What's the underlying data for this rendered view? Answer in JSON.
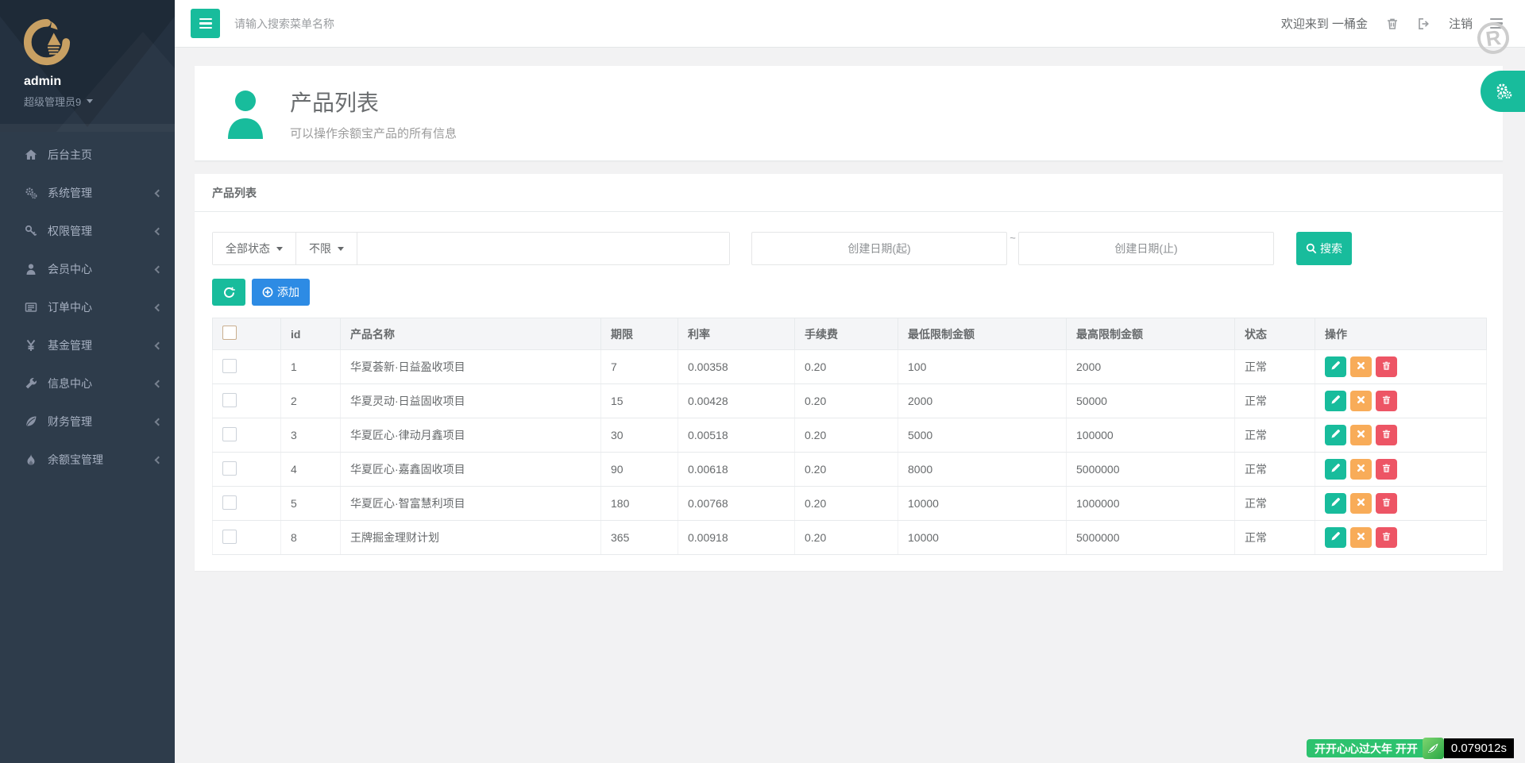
{
  "colors": {
    "accent_teal": "#18bc9c",
    "add_blue": "#2d8be4",
    "warn_orange": "#f8ac59",
    "danger_red": "#ed5565",
    "sidebar_bg": "#2e3c4b",
    "sidebar_profile_bg": "#243140",
    "logo_gold": "#c8a063",
    "festival_green": "#2dc26e",
    "body_bg": "#f2f2f3"
  },
  "sidebar": {
    "username": "admin",
    "role": "超级管理员9",
    "items": [
      {
        "label": "后台主页",
        "icon": "home-icon",
        "has_submenu": false
      },
      {
        "label": "系统管理",
        "icon": "cogs-icon",
        "has_submenu": true
      },
      {
        "label": "权限管理",
        "icon": "key-icon",
        "has_submenu": true
      },
      {
        "label": "会员中心",
        "icon": "user-icon",
        "has_submenu": true
      },
      {
        "label": "订单中心",
        "icon": "list-icon",
        "has_submenu": true
      },
      {
        "label": "基金管理",
        "icon": "yen-icon",
        "has_submenu": true
      },
      {
        "label": "信息中心",
        "icon": "wrench-icon",
        "has_submenu": true
      },
      {
        "label": "财务管理",
        "icon": "leaf-icon",
        "has_submenu": true
      },
      {
        "label": "余额宝管理",
        "icon": "fire-icon",
        "has_submenu": true
      }
    ]
  },
  "topbar": {
    "search_placeholder": "请输入搜索菜单名称",
    "welcome_text": "欢迎来到 一桶金",
    "logout_label": "注销",
    "watermark_letter": "R"
  },
  "page_header": {
    "title": "产品列表",
    "subtitle": "可以操作余额宝产品的所有信息"
  },
  "panel": {
    "title": "产品列表",
    "filters": {
      "status_dropdown": "全部状态",
      "limit_dropdown": "不限",
      "keyword_value": "",
      "date_start_placeholder": "创建日期(起)",
      "date_separator": "~",
      "date_end_placeholder": "创建日期(止)",
      "search_button_label": "搜索",
      "add_button_label": "添加"
    },
    "table": {
      "columns": [
        "id",
        "产品名称",
        "期限",
        "利率",
        "手续费",
        "最低限制金额",
        "最高限制金额",
        "状态",
        "操作"
      ],
      "row_fields": [
        "id",
        "name",
        "term",
        "rate",
        "fee",
        "min",
        "max",
        "status"
      ],
      "rows": [
        {
          "id": "1",
          "name": "华夏荟新·日益盈收项目",
          "term": "7",
          "rate": "0.00358",
          "fee": "0.20",
          "min": "100",
          "max": "2000",
          "status": "正常"
        },
        {
          "id": "2",
          "name": "华夏灵动·日益固收项目",
          "term": "15",
          "rate": "0.00428",
          "fee": "0.20",
          "min": "2000",
          "max": "50000",
          "status": "正常"
        },
        {
          "id": "3",
          "name": "华夏匠心·律动月鑫项目",
          "term": "30",
          "rate": "0.00518",
          "fee": "0.20",
          "min": "5000",
          "max": "100000",
          "status": "正常"
        },
        {
          "id": "4",
          "name": "华夏匠心·嘉鑫固收项目",
          "term": "90",
          "rate": "0.00618",
          "fee": "0.20",
          "min": "8000",
          "max": "5000000",
          "status": "正常"
        },
        {
          "id": "5",
          "name": "华夏匠心·智富慧利项目",
          "term": "180",
          "rate": "0.00768",
          "fee": "0.20",
          "min": "10000",
          "max": "1000000",
          "status": "正常"
        },
        {
          "id": "8",
          "name": "王牌掘金理财计划",
          "term": "365",
          "rate": "0.00918",
          "fee": "0.20",
          "min": "10000",
          "max": "5000000",
          "status": "正常"
        }
      ],
      "row_actions": [
        {
          "name": "edit-icon",
          "class": "act-edit"
        },
        {
          "name": "close-icon",
          "class": "act-close"
        },
        {
          "name": "trash-icon",
          "class": "act-delete"
        }
      ]
    }
  },
  "footer": {
    "festival_text": "开开心心过大年 开开",
    "timer_text": "0.079012s"
  }
}
